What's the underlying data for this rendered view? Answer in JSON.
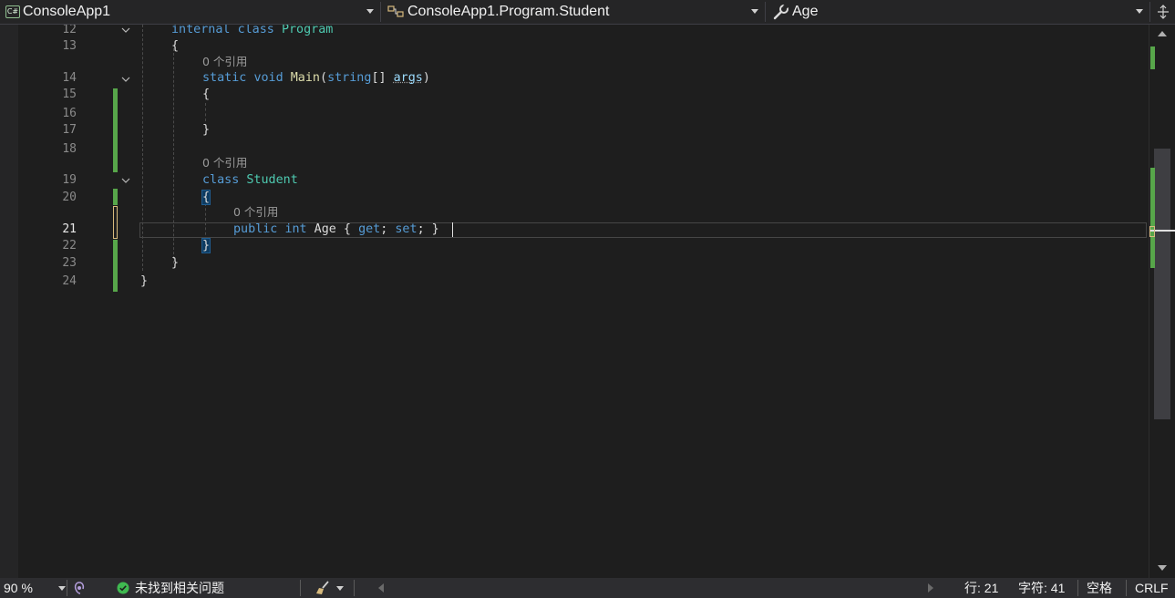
{
  "navbar": {
    "project": {
      "label": "ConsoleApp1",
      "icon": "csharp-project-icon"
    },
    "type": {
      "label": "ConsoleApp1.Program.Student",
      "icon": "class-icon"
    },
    "member": {
      "label": "Age",
      "icon": "wrench-icon"
    },
    "split_icon": "split-window-icon"
  },
  "editor": {
    "lines": [
      {
        "n": "12",
        "code": "internal class Program"
      },
      {
        "n": "13",
        "code": "{"
      },
      {
        "lens": "0 个引用"
      },
      {
        "n": "14",
        "code": "static void Main(string[] args)"
      },
      {
        "n": "15",
        "code": "{"
      },
      {
        "n": "16",
        "code": ""
      },
      {
        "n": "17",
        "code": "}"
      },
      {
        "n": "18",
        "code": ""
      },
      {
        "lens": "0 个引用"
      },
      {
        "n": "19",
        "code": "class Student"
      },
      {
        "n": "20",
        "code": "{"
      },
      {
        "lens": "0 个引用"
      },
      {
        "n": "21",
        "code": "public int Age { get; set; }"
      },
      {
        "n": "22",
        "code": "}"
      },
      {
        "n": "23",
        "code": "}"
      },
      {
        "n": "24",
        "code": "}"
      }
    ]
  },
  "statusbar": {
    "zoom": "90 %",
    "issues": "未找到相关问题",
    "line": "行: 21",
    "char": "字符: 41",
    "spaces": "空格",
    "eol": "CRLF"
  },
  "colors": {
    "background": "#1e1e1e",
    "keyword": "#569cd6",
    "type": "#4ec9b0",
    "method": "#dcdcaa",
    "parameter": "#9cdcfe",
    "change_saved": "#57a64a"
  }
}
